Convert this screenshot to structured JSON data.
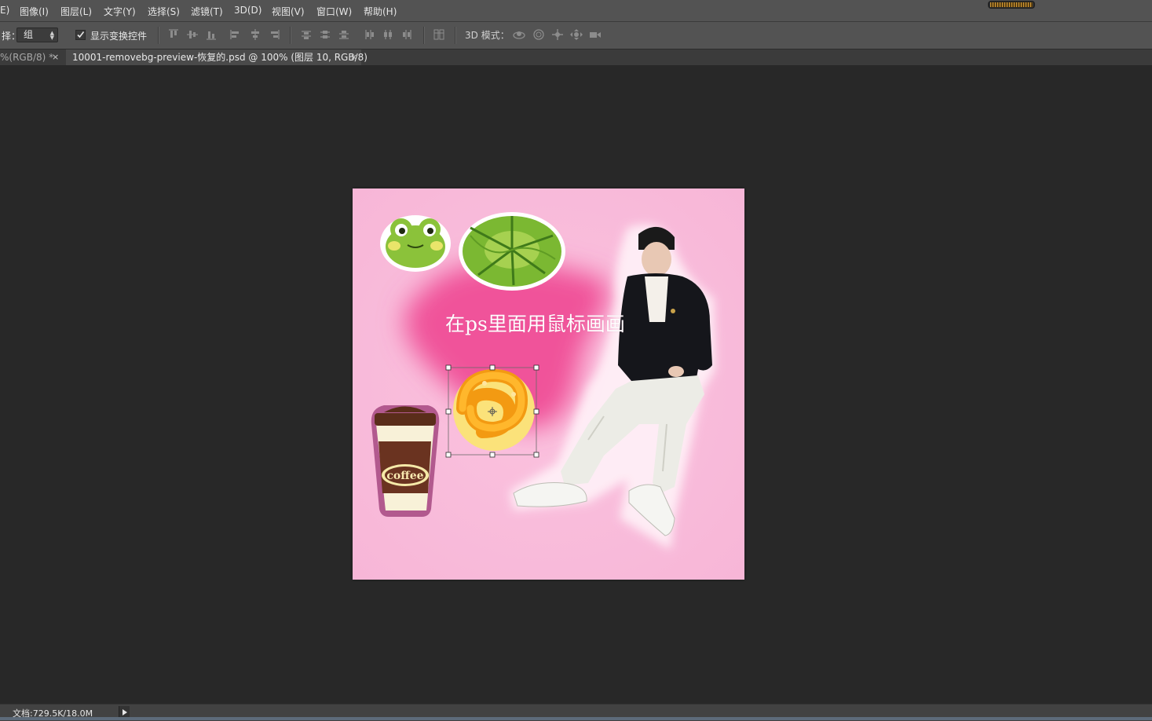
{
  "menubar": {
    "items": [
      "E)",
      "图像(I)",
      "图层(L)",
      "文字(Y)",
      "选择(S)",
      "滤镜(T)",
      "3D(D)",
      "视图(V)",
      "窗口(W)",
      "帮助(H)"
    ]
  },
  "options": {
    "auto_select_label": "择：",
    "auto_select_value": "组",
    "show_transform_checked": true,
    "show_transform_label": "显示变换控件",
    "mode3d_label": "3D 模式："
  },
  "tabs": [
    {
      "label": "%(RGB/8) *",
      "active": false
    },
    {
      "label": "10001-removebg-preview-恢复的.psd @ 100% (图层 10, RGB/8)",
      "active": true
    }
  ],
  "canvas": {
    "text_layer": "在ps里面用鼠标画画",
    "coffee_text": "coffee",
    "background_color": "#f9bddb",
    "blob_color": "#f0529a"
  },
  "status": {
    "doc_size": "文档:729.5K/18.0M"
  },
  "icons": {
    "tab_close": "×",
    "checkbox": "checkmark-icon",
    "status_menu": "triangle-right-icon"
  }
}
